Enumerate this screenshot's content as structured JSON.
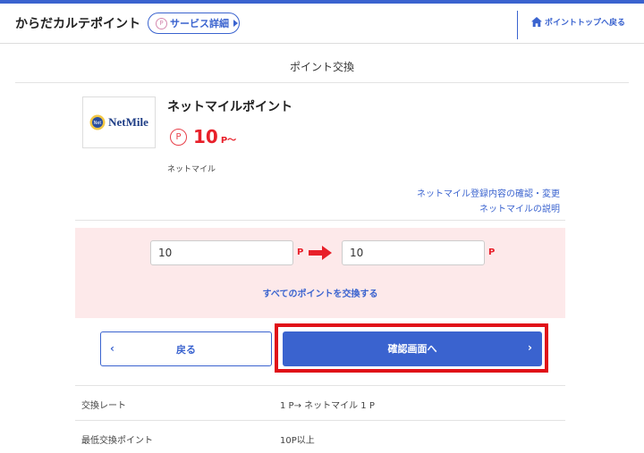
{
  "header": {
    "app_title": "からだカルテポイント",
    "service_button": "サービス詳細",
    "service_p": "P",
    "top_link": "ポイントトップへ戻る"
  },
  "section_title": "ポイント交換",
  "partner": {
    "logo_text": "NetMile",
    "logo_badge": "Net",
    "name": "ネットマイルポイント",
    "rate_symbol": "P",
    "rate_value": "10",
    "rate_unit": "P～",
    "provider": "ネットマイル",
    "link_confirm": "ネットマイル登録内容の確認・変更",
    "link_explain": "ネットマイルの説明"
  },
  "exchange": {
    "from_value": "10",
    "from_unit": "P",
    "to_value": "10",
    "to_unit": "P",
    "all_points_link": "すべてのポイントを交換する"
  },
  "buttons": {
    "back": "戻る",
    "confirm": "確認画面へ"
  },
  "info": [
    {
      "label": "交換レート",
      "value": "1 P→ ネットマイル 1 P"
    },
    {
      "label": "最低交換ポイント",
      "value": "10P以上"
    }
  ],
  "colors": {
    "accent": "#3a63cf",
    "point_red": "#e8202a",
    "exchange_bg": "#fde9ea",
    "highlight": "#e01018"
  }
}
